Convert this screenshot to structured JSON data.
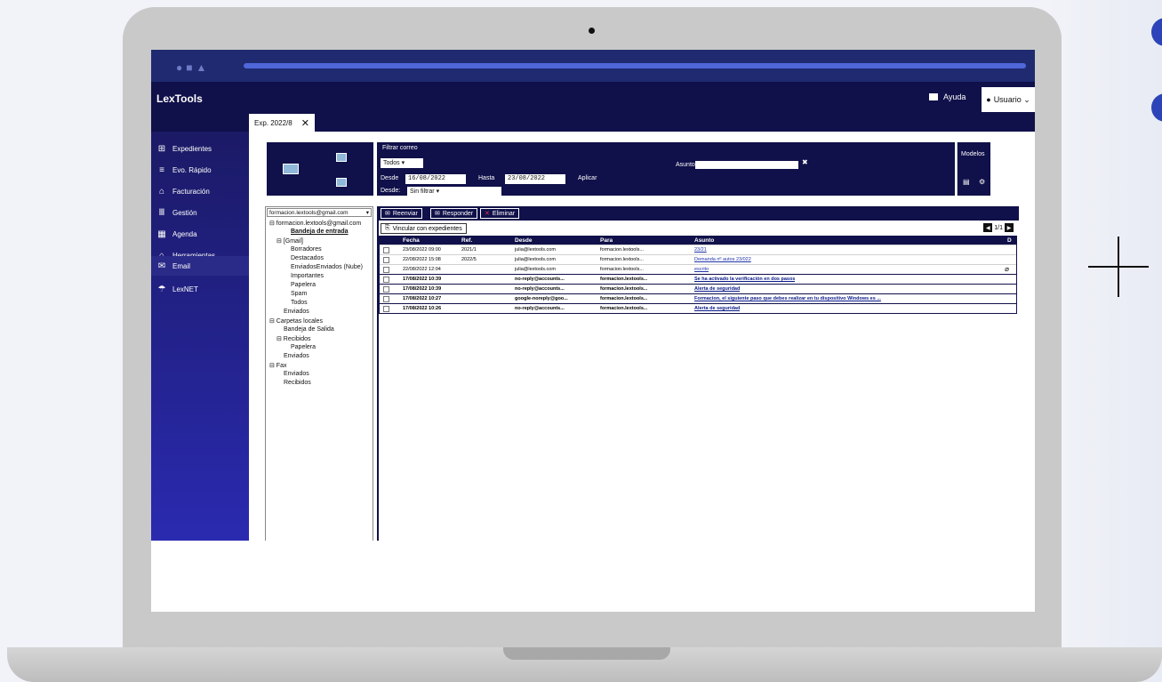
{
  "app": {
    "logo": "LexTools",
    "help_label": "Ayuda",
    "user_label": "Usuario ⌄",
    "tab_label": "Exp. 2022/8",
    "tab_close": "✕"
  },
  "sidebar": {
    "items": [
      {
        "label": "Expedientes",
        "icon": "folders-icon"
      },
      {
        "label": "Evo. Rápido",
        "icon": "lightning-icon"
      },
      {
        "label": "Facturación",
        "icon": "billing-icon"
      },
      {
        "label": "Gestión",
        "icon": "bank-icon"
      },
      {
        "label": "Agenda",
        "icon": "calendar-icon"
      },
      {
        "label": "Herramientas",
        "icon": "tools-icon"
      },
      {
        "label": "Email",
        "icon": "mail-icon"
      },
      {
        "label": "LexNET",
        "icon": "network-icon"
      }
    ]
  },
  "filter": {
    "title": "Filtrar correo",
    "type_value": "Todos",
    "from_label": "Desde",
    "from_date": "16/08/2022",
    "to_label": "Hasta",
    "to_date": "23/08/2022",
    "apply_label": "Aplicar",
    "source_label": "Desde:",
    "source_value": "Sin filtrar",
    "subject_label": "Asunto",
    "clear_icon": "✖"
  },
  "models": {
    "label": "Modelos"
  },
  "accounts": {
    "selected": "formacion.lextools@gmail.com",
    "tree": [
      {
        "label": "⊟ formacion.lextools@gmail.com",
        "indent": 0
      },
      {
        "label": "Bandeja de entrada",
        "indent": 3,
        "bold": true
      },
      {
        "label": "⊟ [Gmail]",
        "indent": 1
      },
      {
        "label": "Borradores",
        "indent": 3
      },
      {
        "label": "Destacados",
        "indent": 3
      },
      {
        "label": "EnviadosEnviados (Nube)",
        "indent": 3
      },
      {
        "label": "Importantes",
        "indent": 3
      },
      {
        "label": "Papelera",
        "indent": 3
      },
      {
        "label": "Spam",
        "indent": 3
      },
      {
        "label": "Todos",
        "indent": 3
      },
      {
        "label": "Enviados",
        "indent": 2
      },
      {
        "label": "⊟ Carpetas locales",
        "indent": 0
      },
      {
        "label": "Bandeja de Salida",
        "indent": 2
      },
      {
        "label": "⊟ Recibidos",
        "indent": 1
      },
      {
        "label": "Papelera",
        "indent": 3
      },
      {
        "label": "Enviados",
        "indent": 2
      },
      {
        "label": "⊟ Fax",
        "indent": 0
      },
      {
        "label": "Enviados",
        "indent": 2
      },
      {
        "label": "Recibidos",
        "indent": 2
      }
    ]
  },
  "actions": {
    "forward": "Reenviar",
    "reply": "Responder",
    "delete": "Eliminar",
    "link": "Vincular con expedientes",
    "pager": "1/1"
  },
  "grid": {
    "headers": {
      "fecha": "Fecha",
      "ref": "Ref.",
      "desde": "Desde",
      "para": "Para",
      "asunto": "Asunto",
      "d": "D"
    },
    "rows": [
      {
        "fecha": "23/08/2022 09:00",
        "ref": "2021/1",
        "desde": "julia@lextools.com",
        "para": "formacion.lextools...",
        "asunto": "23/21",
        "unread": false,
        "attach": false
      },
      {
        "fecha": "22/08/2022 15:08",
        "ref": "2022/5",
        "desde": "julia@lextools.com",
        "para": "formacion.lextools...",
        "asunto": "Demanda nº autos 23/022",
        "unread": false,
        "attach": false
      },
      {
        "fecha": "22/08/2022 12:04",
        "ref": "",
        "desde": "julia@lextools.com",
        "para": "formacion.lextools...",
        "asunto": "escrito",
        "unread": false,
        "attach": true
      },
      {
        "fecha": "17/08/2022 10:39",
        "ref": "",
        "desde": "no-reply@accounts...",
        "para": "formacion.lextools...",
        "asunto": "Se ha activado la verificación en dos pasos",
        "unread": true,
        "attach": false
      },
      {
        "fecha": "17/08/2022 10:39",
        "ref": "",
        "desde": "no-reply@accounts...",
        "para": "formacion.lextools...",
        "asunto": "Alerta de seguridad",
        "unread": true,
        "attach": false
      },
      {
        "fecha": "17/08/2022 10:27",
        "ref": "",
        "desde": "google-noreply@goo...",
        "para": "formacion.lextools...",
        "asunto": "Formacion, el siguiente paso que debes realizar en tu dispositivo Windows es ...",
        "unread": true,
        "attach": false
      },
      {
        "fecha": "17/08/2022 10:26",
        "ref": "",
        "desde": "no-reply@accounts...",
        "para": "formacion.lextools...",
        "asunto": "Alerta de seguridad",
        "unread": true,
        "attach": false
      }
    ]
  },
  "colors": {
    "navy": "#10104a",
    "accent": "#2c44b8"
  }
}
